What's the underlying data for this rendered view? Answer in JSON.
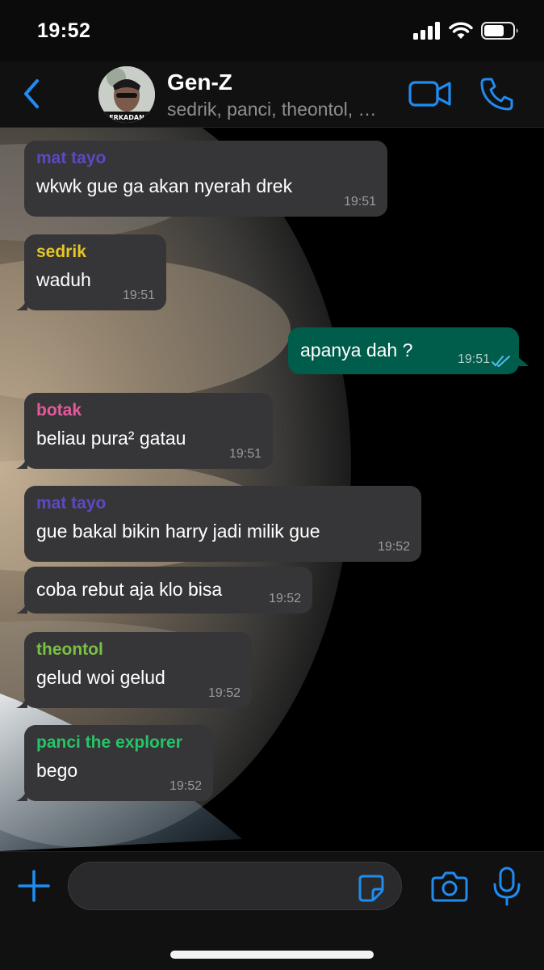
{
  "status_bar": {
    "time": "19:52"
  },
  "header": {
    "group_name": "Gen-Z",
    "members": "sedrik, panci, theontol, mat tayo, botak",
    "avatar_text": "ERKADAN"
  },
  "messages": [
    {
      "sender": "mat tayo",
      "sender_color": "#5e48c4",
      "text": "wkwk gue ga akan nyerah drek",
      "time": "19:51"
    },
    {
      "sender": "sedrik",
      "sender_color": "#e6c626",
      "text": "waduh",
      "time": "19:51"
    },
    {
      "sender": "",
      "text": "apanya dah ?",
      "time": "19:51",
      "outgoing": true,
      "status": "read"
    },
    {
      "sender": "botak",
      "sender_color": "#e55a9b",
      "text": "beliau pura² gatau",
      "time": "19:51"
    },
    {
      "sender": "mat tayo",
      "sender_color": "#5e48c4",
      "text": "gue bakal bikin harry jadi milik gue",
      "time": "19:52"
    },
    {
      "sender": "",
      "text": "coba rebut aja klo bisa",
      "time": "19:52"
    },
    {
      "sender": "theontol",
      "sender_color": "#7ac142",
      "text": "gelud woi gelud",
      "time": "19:52"
    },
    {
      "sender": "panci the explorer",
      "sender_color": "#27c467",
      "text": "bego",
      "time": "19:52"
    }
  ],
  "input": {
    "value": "",
    "placeholder": ""
  },
  "colors": {
    "accent": "#1f8cf2",
    "outgoing_bubble": "#005c4b",
    "incoming_bubble": "#363638",
    "read_ticks": "#53bdeb"
  },
  "icons": [
    "back-chevron-icon",
    "video-call-icon",
    "phone-icon",
    "plus-icon",
    "sticker-icon",
    "camera-icon",
    "microphone-icon",
    "signal-icon",
    "wifi-icon",
    "battery-icon"
  ]
}
